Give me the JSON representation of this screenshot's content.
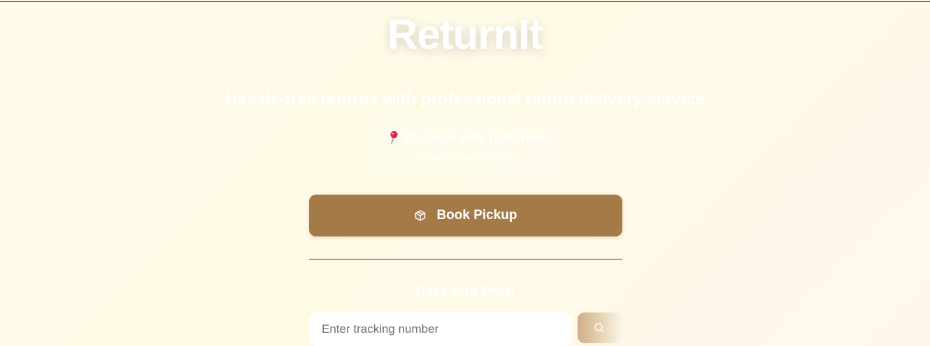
{
  "header": {
    "brand": "ReturnIt",
    "tagline": "Hassle-free returns with professional return delivery service"
  },
  "location": {
    "icon": "map-pin-icon",
    "title": "St. Louis only right now",
    "subtitle": "Coming to your city soon!"
  },
  "actions": {
    "book_icon": "package-icon",
    "book_label": "Book Pickup"
  },
  "tracking": {
    "heading": "Track Your Order",
    "placeholder": "Enter tracking number",
    "value": "",
    "search_icon": "search-icon"
  },
  "colors": {
    "background": "#fffbe8",
    "accent": "#a47b47",
    "pin": "#e0245e"
  }
}
